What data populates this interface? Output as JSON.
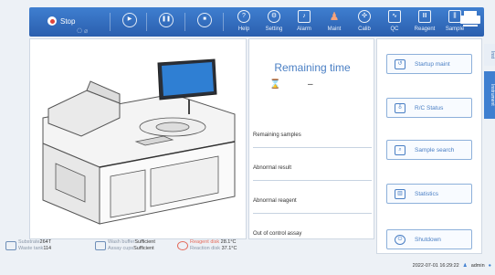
{
  "toolbar": {
    "stop_label": "Stop",
    "items": [
      {
        "label": "Help",
        "icon": "help-icon",
        "glyph": "?"
      },
      {
        "label": "Setting",
        "icon": "gear-icon",
        "glyph": "⚙"
      },
      {
        "label": "Alarm",
        "icon": "alarm-icon",
        "glyph": "♪"
      },
      {
        "label": "Maint",
        "icon": "maint-icon",
        "glyph": "♟"
      },
      {
        "label": "Calib",
        "icon": "calib-icon",
        "glyph": "✣"
      },
      {
        "label": "QC",
        "icon": "qc-icon",
        "glyph": "∿"
      },
      {
        "label": "Reagent",
        "icon": "reagent-icon",
        "glyph": "Ⅲ"
      },
      {
        "label": "Sample",
        "icon": "sample-icon",
        "glyph": "⫼"
      }
    ]
  },
  "status": {
    "substrate_label": "Substrate",
    "substrate_value": "264T",
    "waste_label": "Waste tank",
    "waste_value": "114",
    "wash_label": "Wash buffer",
    "wash_value": "Sufficient",
    "cups_label": "Assay cups",
    "cups_value": "Sufficient",
    "reagent_disk_label": "Reagent disk",
    "reagent_disk_value": "28.1°C",
    "reaction_disk_label": "Reaction disk",
    "reaction_disk_value": "37.1°C"
  },
  "remaining": {
    "title": "Remaining time",
    "value": "–",
    "rows": [
      "Remaining samples",
      "Abnormal result",
      "Abnormal reagent",
      "Out of control assay"
    ]
  },
  "actions": [
    {
      "label": "Startup maint",
      "icon": "startup-icon"
    },
    {
      "label": "R/C Status",
      "icon": "rc-status-icon"
    },
    {
      "label": "Sample search",
      "icon": "search-icon"
    },
    {
      "label": "Statistics",
      "icon": "statistics-icon"
    },
    {
      "label": "Shutdown",
      "icon": "power-icon"
    }
  ],
  "side_tabs": [
    "Inst",
    "Instrument"
  ],
  "footer": {
    "datetime": "2022-07-01 16:29:22",
    "user": "admin"
  },
  "colors": {
    "toolbar": "#2f6bbd",
    "accent": "#4a7fc4",
    "alert": "#e46a5a"
  }
}
